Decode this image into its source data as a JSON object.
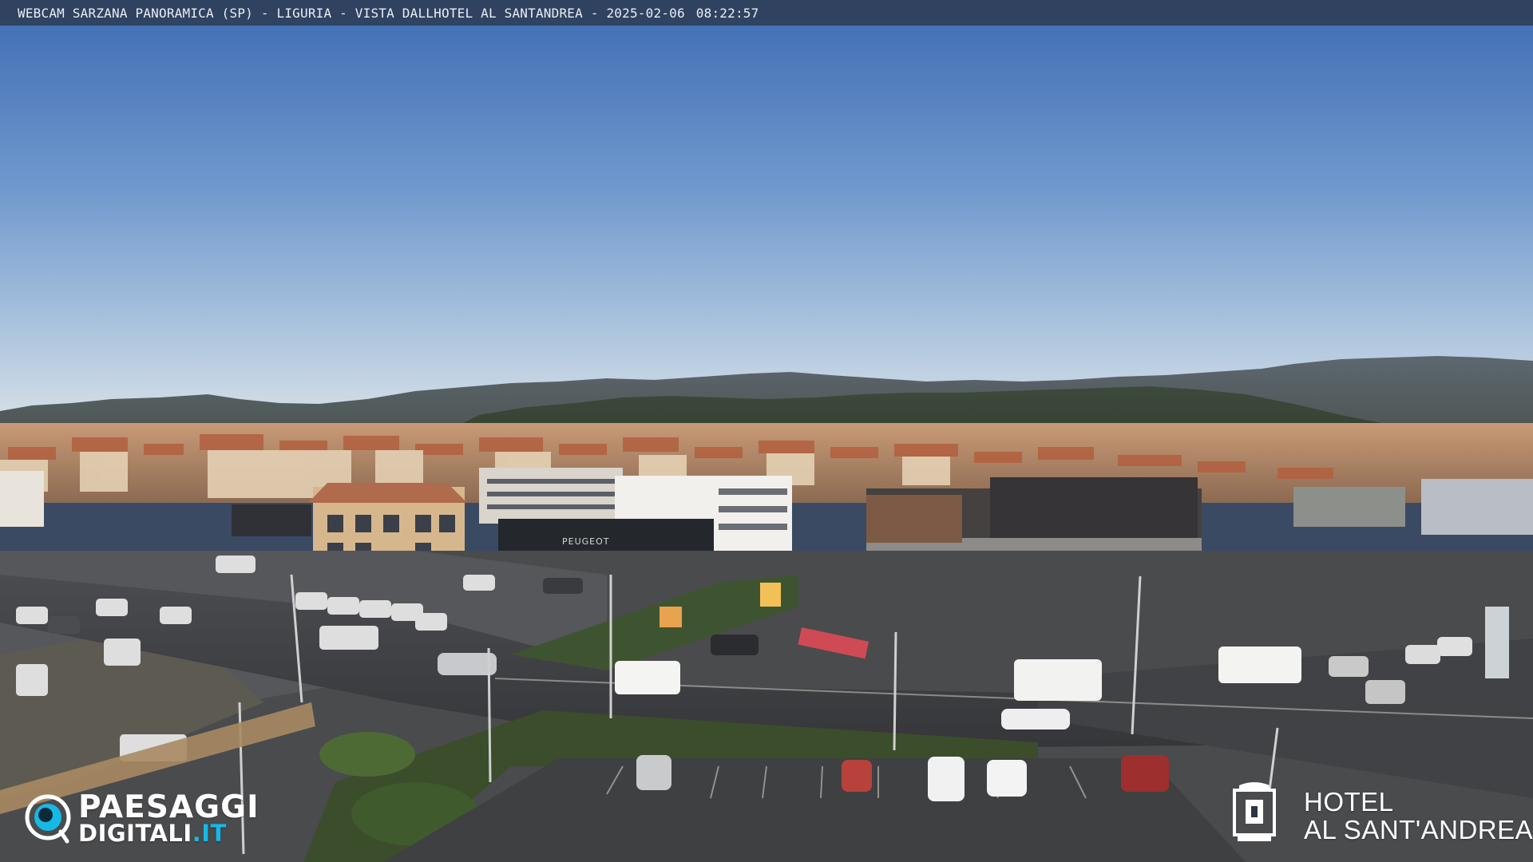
{
  "caption": {
    "location": "WEBCAM SARZANA PANORAMICA (SP) - LIGURIA - VISTA DALLHOTEL AL SANTANDREA - 2025-02-06",
    "time": "08:22:57"
  },
  "logo_left": {
    "line1": "PAESAGGI",
    "line2_main": "DIGITALI",
    "line2_accent": ".IT",
    "icon": "eye-logo-icon"
  },
  "logo_right": {
    "line1": "HOTEL",
    "line2": "AL SANT'ANDREA",
    "icon": "hotel-crest-icon"
  },
  "signs": {
    "dealer": "PEUGEOT",
    "dealer2": "PEUGEOT"
  },
  "colors": {
    "sky_top": "#3d6db6",
    "sky_bottom": "#c9d7e4",
    "accent_blue": "#16b9e6",
    "caption_bg": "#2d3c54"
  }
}
